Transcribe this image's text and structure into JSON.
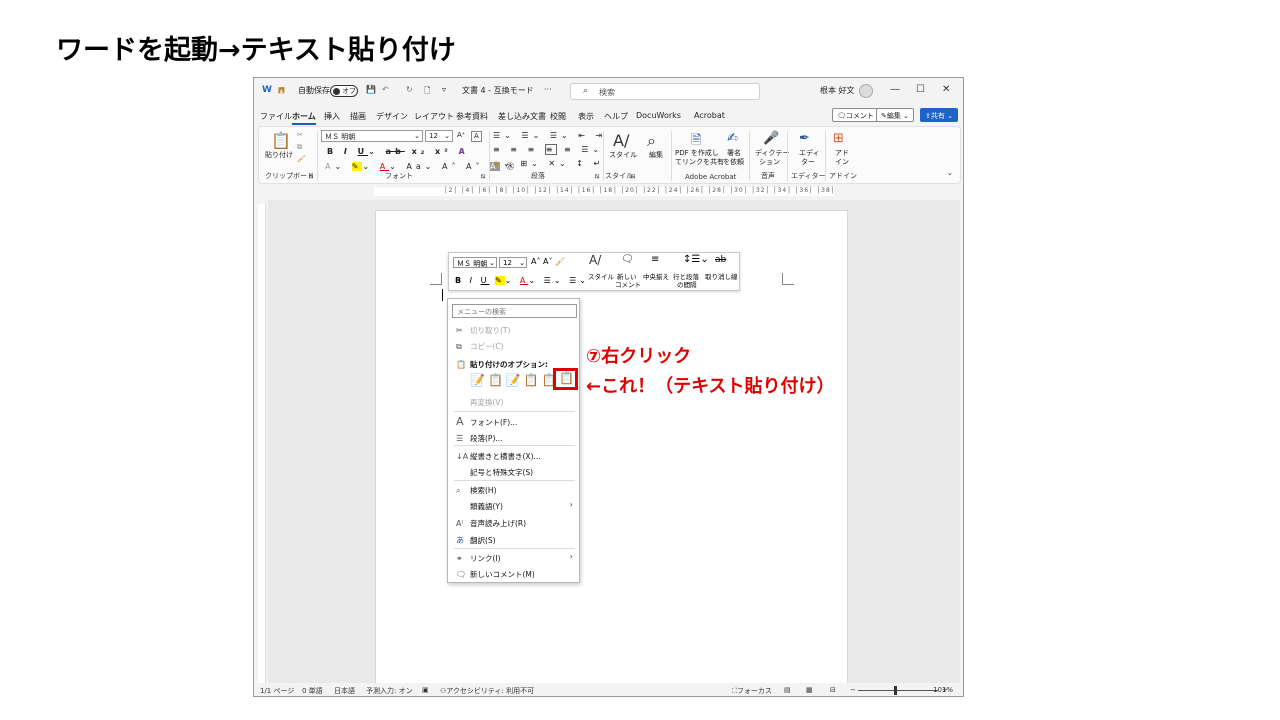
{
  "slide_title": "ワードを起動→テキスト貼り付け",
  "titlebar": {
    "autosave_label": "自動保存",
    "autosave_state": "オフ",
    "doc_title": "文書 4 - 互換モード",
    "doc_title_suffix": "···",
    "search_placeholder": "検索",
    "user_name": "根本 好文",
    "minimize": "—",
    "maximize": "☐",
    "close": "✕"
  },
  "menu": {
    "tabs": [
      "ファイル",
      "ホーム",
      "挿入",
      "描画",
      "デザイン",
      "レイアウト",
      "参考資料",
      "差し込み文書",
      "校閲",
      "表示",
      "ヘルプ",
      "DocuWorks",
      "Acrobat"
    ],
    "active": "ホーム",
    "comment_btn": "コメント",
    "edit_btn": "編集",
    "share_btn": "共有"
  },
  "ribbon": {
    "paste": "貼り付け",
    "font_name": "ＭＳ 明朝",
    "font_size": "12",
    "group_clipboard": "クリップボード",
    "group_font": "フォント",
    "group_paragraph": "段落",
    "group_style": "スタイル",
    "group_acrobat": "Adobe Acrobat",
    "group_voice": "音声",
    "group_editor": "エディター",
    "group_addin": "アドイン",
    "style_btn": "スタイル",
    "edit_btn": "編集",
    "pdf_btn_1": "PDF を作成し",
    "pdf_btn_2": "てリンクを共有",
    "sign_btn_1": "署名",
    "sign_btn_2": "を依頼",
    "dictate_1": "ディクテー",
    "dictate_2": "ション",
    "editor_1": "エディ",
    "editor_2": "ター",
    "addin_1": "アド",
    "addin_2": "イン"
  },
  "ruler_numbers": "│2│ │4│ │6│ │8│ │10│ │12│ │14│ │16│ │18│ │20│ │22│ │24│ │26│ │28│ │30│ │32│ │34│ │36│ │38│",
  "minitoolbar": {
    "font_name": "ＭＳ 明朝",
    "font_size": "12",
    "style": "スタイル",
    "new_comment_1": "新しい",
    "new_comment_2": "コメント",
    "center": "中央揃え",
    "line_spacing_1": "行と段落",
    "line_spacing_2": "の間隔",
    "strikethrough": "取り消し線"
  },
  "context_menu": {
    "search_placeholder": "メニューの検索",
    "cut": "切り取り(T)",
    "copy": "コピー(C)",
    "paste_options": "貼り付けのオプション:",
    "reconvert": "再変換(V)",
    "font": "フォント(F)...",
    "paragraph": "段落(P)...",
    "vertical": "縦書きと横書き(X)...",
    "symbols": "記号と特殊文字(S)",
    "search": "検索(H)",
    "synonyms": "類義語(Y)",
    "read_aloud": "音声読み上げ(R)",
    "translate": "翻訳(S)",
    "link": "リンク(I)",
    "new_comment": "新しいコメント(M)"
  },
  "annotations": {
    "step": "⑦右クリック",
    "pointer": "←これ！（テキスト貼り付け）"
  },
  "statusbar": {
    "page": "1/1 ページ",
    "words": "0 単語",
    "language": "日本語",
    "predict": "予測入力: オン",
    "accessibility": "アクセシビリティ: 利用不可",
    "focus": "フォーカス",
    "zoom": "101%"
  },
  "colors": {
    "accent_blue": "#1e63c9",
    "annotation_red": "#e00000"
  }
}
